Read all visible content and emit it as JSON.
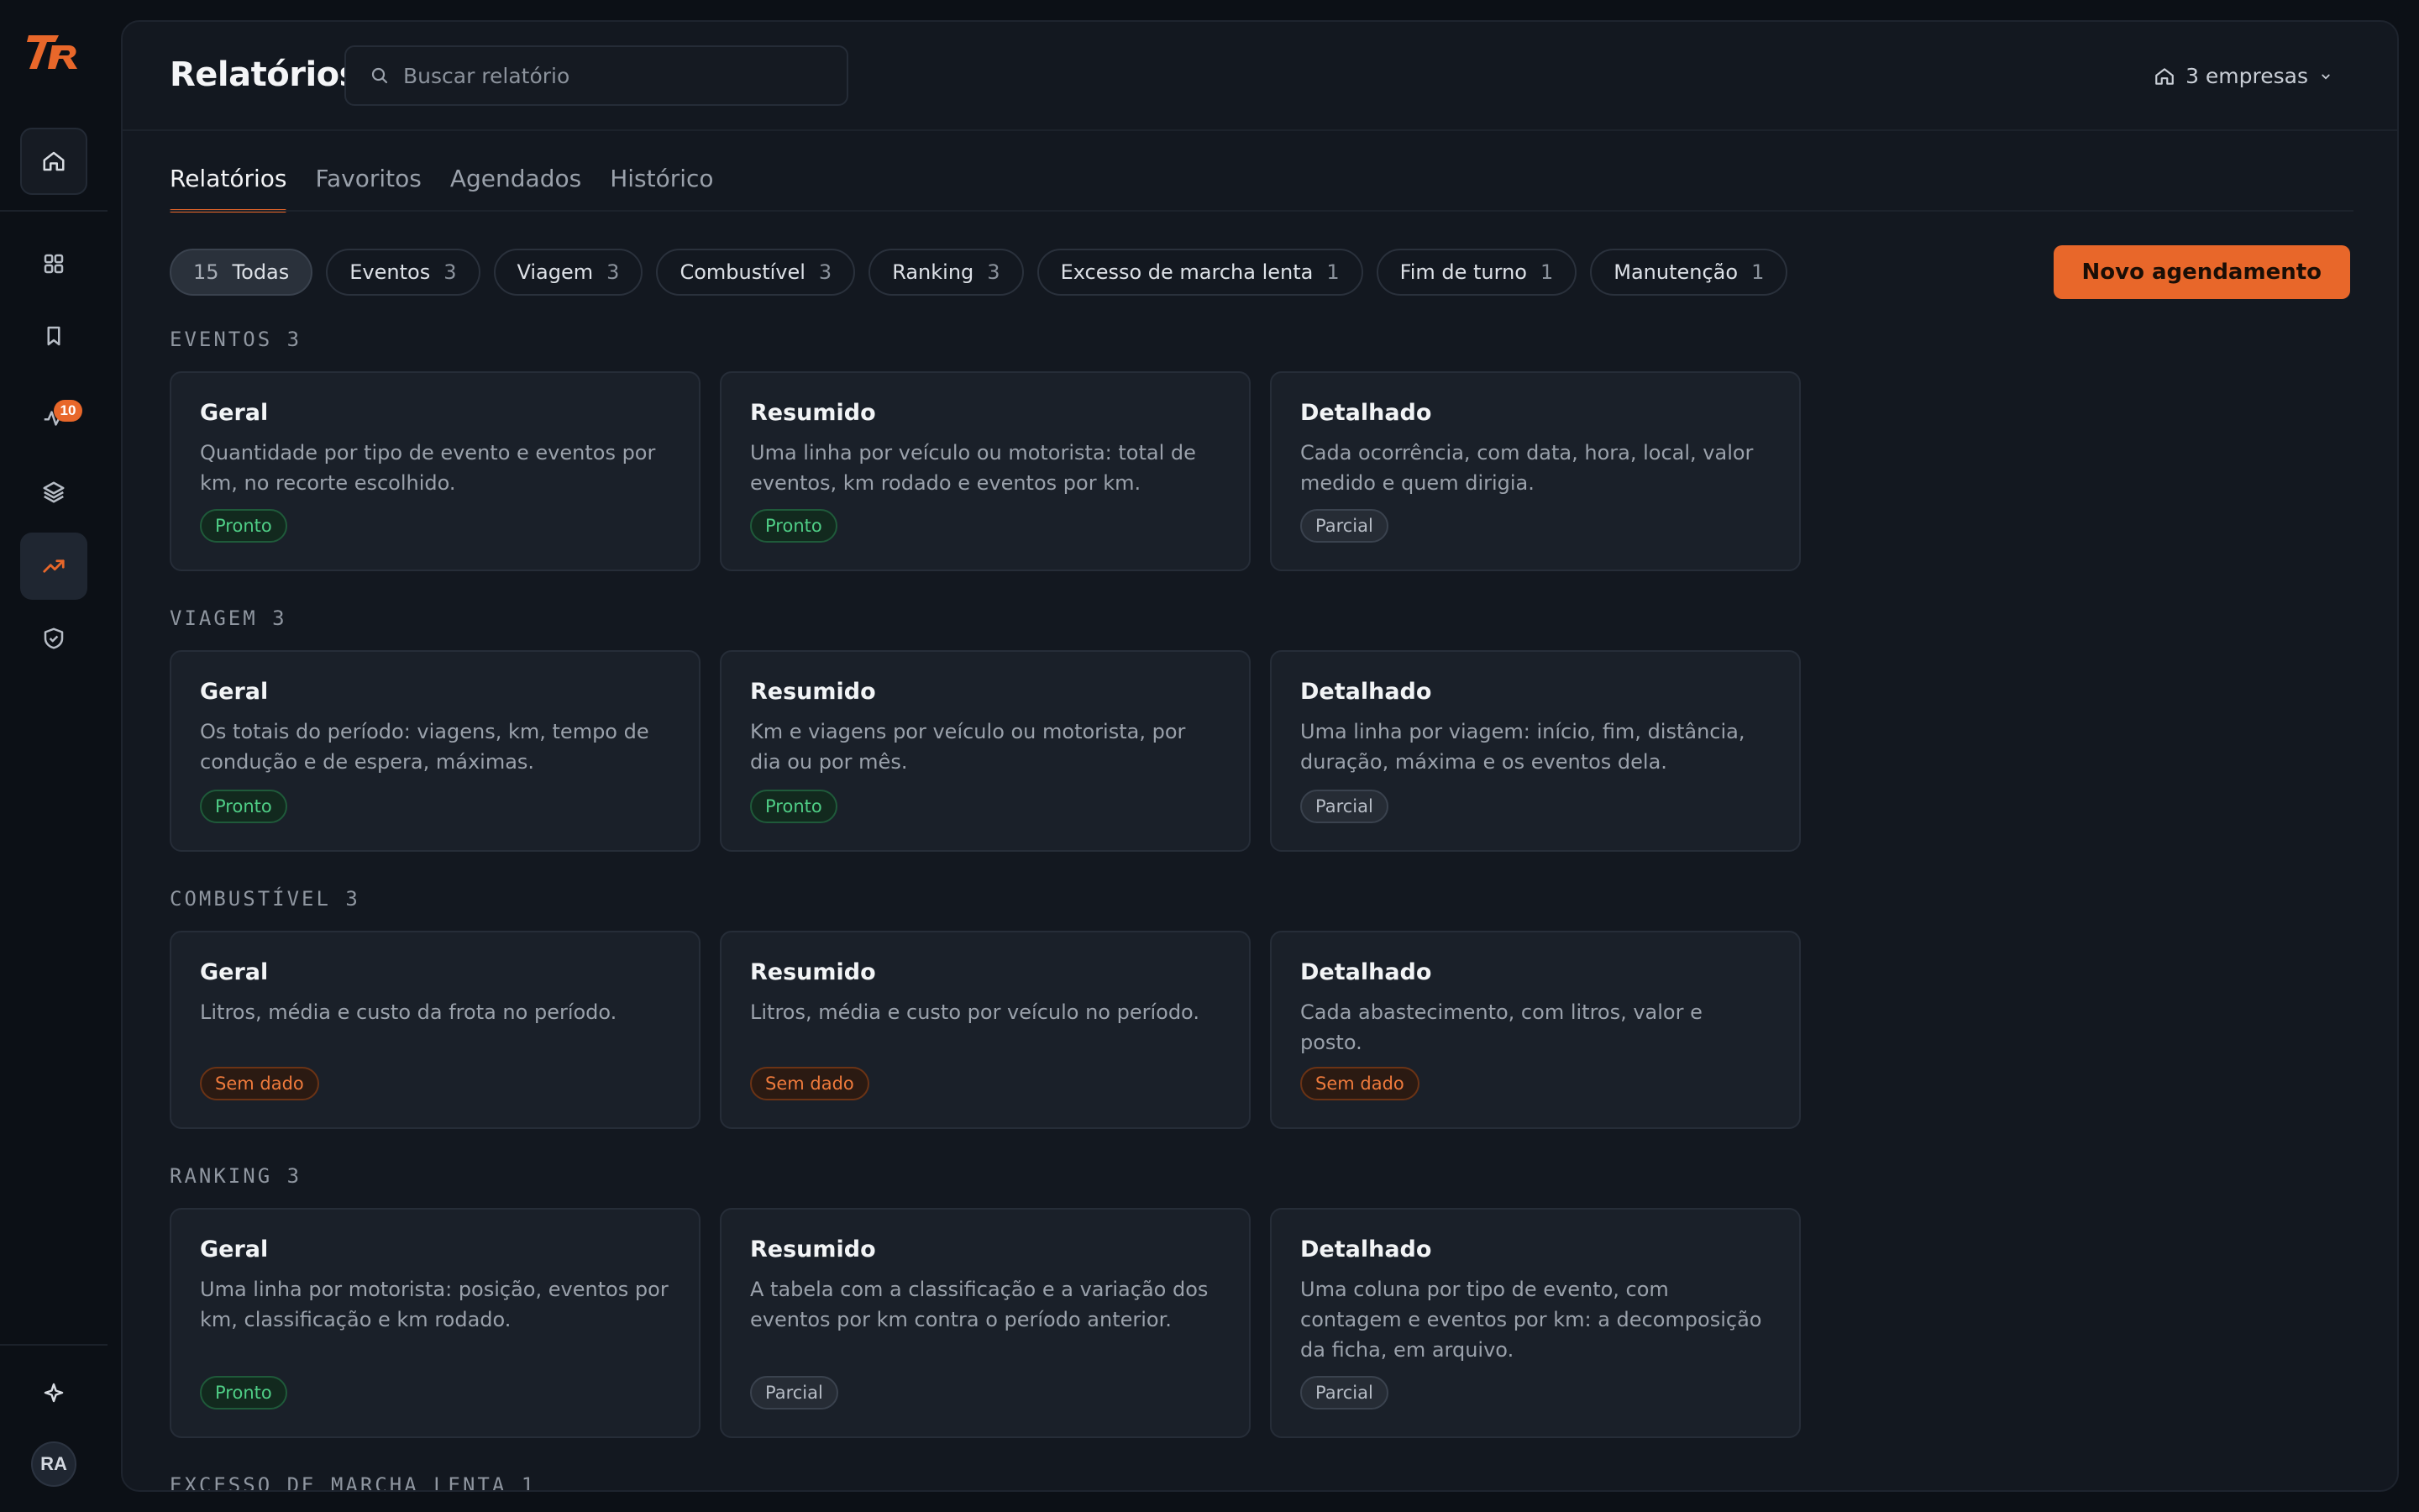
{
  "rail": {
    "logo": "TR",
    "badge_count": "10",
    "avatar": "RA"
  },
  "header": {
    "title": "Relatórios",
    "search_placeholder": "Buscar relatório",
    "companies": "3 empresas"
  },
  "tabs": [
    "Relatórios",
    "Favoritos",
    "Agendados",
    "Histórico"
  ],
  "chips": [
    {
      "count": "15",
      "label": "Todas"
    },
    {
      "label": "Eventos",
      "count": "3"
    },
    {
      "label": "Viagem",
      "count": "3"
    },
    {
      "label": "Combustível",
      "count": "3"
    },
    {
      "label": "Ranking",
      "count": "3"
    },
    {
      "label": "Excesso de marcha lenta",
      "count": "1"
    },
    {
      "label": "Fim de turno",
      "count": "1"
    },
    {
      "label": "Manutenção",
      "count": "1"
    }
  ],
  "new_schedule": "Novo agendamento",
  "sections": [
    {
      "title": "EVENTOS 3",
      "cards": [
        {
          "title": "Geral",
          "desc": "Quantidade por tipo de evento e eventos por km, no recorte escolhido.",
          "status": "Pronto"
        },
        {
          "title": "Resumido",
          "desc": "Uma linha por veículo ou motorista: total de eventos, km rodado e eventos por km.",
          "status": "Pronto"
        },
        {
          "title": "Detalhado",
          "desc": "Cada ocorrência, com data, hora, local, valor medido e quem dirigia.",
          "status": "Parcial"
        }
      ]
    },
    {
      "title": "VIAGEM 3",
      "cards": [
        {
          "title": "Geral",
          "desc": "Os totais do período: viagens, km, tempo de condução e de espera, máximas.",
          "status": "Pronto"
        },
        {
          "title": "Resumido",
          "desc": "Km e viagens por veículo ou motorista, por dia ou por mês.",
          "status": "Pronto"
        },
        {
          "title": "Detalhado",
          "desc": "Uma linha por viagem: início, fim, distância, duração, máxima e os eventos dela.",
          "status": "Parcial"
        }
      ]
    },
    {
      "title": "COMBUSTÍVEL 3",
      "cards": [
        {
          "title": "Geral",
          "desc": "Litros, média e custo da frota no período.",
          "status": "Sem dado"
        },
        {
          "title": "Resumido",
          "desc": "Litros, média e custo por veículo no período.",
          "status": "Sem dado"
        },
        {
          "title": "Detalhado",
          "desc": "Cada abastecimento, com litros, valor e posto.",
          "status": "Sem dado"
        }
      ]
    },
    {
      "title": "RANKING 3",
      "cards": [
        {
          "title": "Geral",
          "desc": "Uma linha por motorista: posição, eventos por km, classificação e km rodado.",
          "status": "Pronto"
        },
        {
          "title": "Resumido",
          "desc": "A tabela com a classificação e a variação dos eventos por km contra o período anterior.",
          "status": "Parcial"
        },
        {
          "title": "Detalhado",
          "desc": "Uma coluna por tipo de evento, com contagem e eventos por km: a decomposição da ficha, em arquivo.",
          "status": "Parcial"
        }
      ]
    },
    {
      "title": "EXCESSO DE MARCHA LENTA 1",
      "cards": []
    }
  ],
  "colors": {
    "accent": "#e8672a",
    "ready": "#4fce86",
    "nodata": "#ee7a3c"
  }
}
